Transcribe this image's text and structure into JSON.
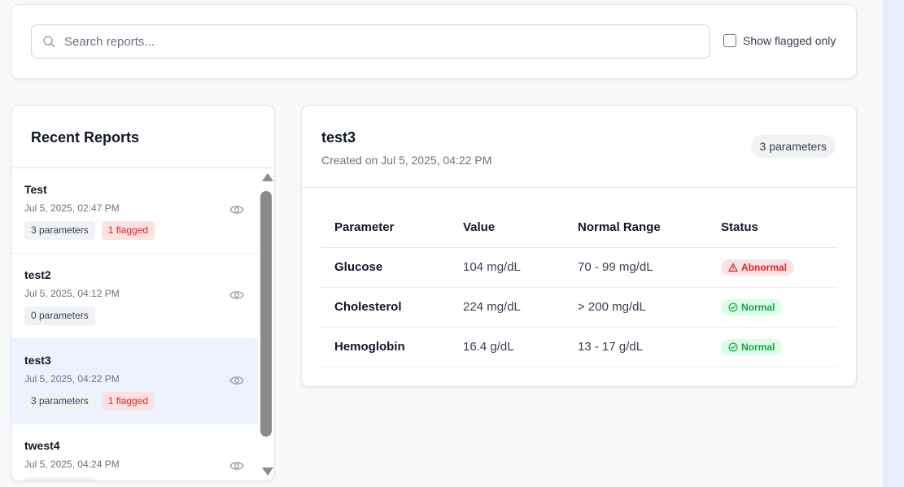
{
  "search": {
    "placeholder": "Search reports..."
  },
  "filter": {
    "label": "Show flagged only",
    "checked": false
  },
  "reports_list": {
    "title": "Recent Reports",
    "items": [
      {
        "name": "Test",
        "date": "Jul 5, 2025, 02:47 PM",
        "params": "3 parameters",
        "flagged": "1 flagged"
      },
      {
        "name": "test2",
        "date": "Jul 5, 2025, 04:12 PM",
        "params": "0 parameters",
        "flagged": ""
      },
      {
        "name": "test3",
        "date": "Jul 5, 2025, 04:22 PM",
        "params": "3 parameters",
        "flagged": "1 flagged"
      },
      {
        "name": "twest4",
        "date": "Jul 5, 2025, 04:24 PM",
        "params": "",
        "flagged": ""
      }
    ],
    "selected_index": 2
  },
  "detail": {
    "title": "test3",
    "created": "Created on Jul 5, 2025, 04:22 PM",
    "param_count": "3 parameters",
    "columns": [
      "Parameter",
      "Value",
      "Normal Range",
      "Status"
    ],
    "rows": [
      {
        "parameter": "Glucose",
        "value": "104 mg/dL",
        "range": "70 - 99 mg/dL",
        "status": "Abnormal"
      },
      {
        "parameter": "Cholesterol",
        "value": "224 mg/dL",
        "range": "> 200 mg/dL",
        "status": "Normal"
      },
      {
        "parameter": "Hemoglobin",
        "value": "16.4 g/dL",
        "range": "13 - 17 g/dL",
        "status": "Normal"
      }
    ]
  },
  "colors": {
    "abnormal": "#dc2626",
    "normal": "#16a34a",
    "selected_row": "#eef2fe",
    "side_strip": "#e8edfb"
  },
  "icons": [
    "search-icon",
    "eye-icon",
    "warning-triangle-icon",
    "check-circle-icon",
    "scroll-up-arrow",
    "scroll-down-arrow"
  ]
}
